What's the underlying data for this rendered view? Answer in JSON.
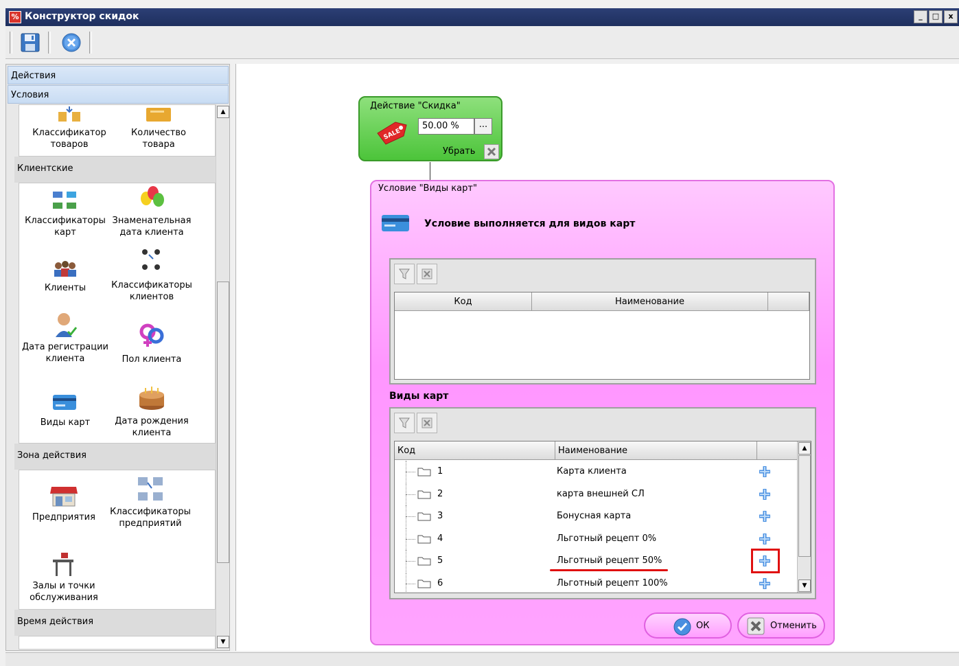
{
  "window": {
    "title": "Конструктор скидок",
    "app_icon_glyph": "%",
    "buttons": [
      "_",
      "□",
      "x"
    ]
  },
  "toolbar": {
    "icons": [
      "save-icon",
      "cancel-circle-icon"
    ]
  },
  "sidebar": {
    "headers": [
      "Действия",
      "Условия"
    ],
    "top_tiles": [
      {
        "label": "Классификатор товаров",
        "icon": "goods-classifier-icon"
      },
      {
        "label": "Количество товара",
        "icon": "goods-quantity-icon"
      }
    ],
    "sections": [
      {
        "title": "Клиентские",
        "tiles": [
          {
            "label": "Классификаторы карт",
            "icon": "card-classifier-icon"
          },
          {
            "label": "Знаменательная дата клиента",
            "icon": "balloons-icon"
          },
          {
            "label": "Клиенты",
            "icon": "clients-icon"
          },
          {
            "label": "Классификаторы клиентов",
            "icon": "client-classifier-icon"
          },
          {
            "label": "Дата регистрации клиента",
            "icon": "registration-date-icon"
          },
          {
            "label": "Пол клиента",
            "icon": "gender-icon"
          },
          {
            "label": "Виды карт",
            "icon": "cards-icon"
          },
          {
            "label": "Дата рождения клиента",
            "icon": "birthday-cake-icon"
          }
        ]
      },
      {
        "title": "Зона действия",
        "tiles": [
          {
            "label": "Предприятия",
            "icon": "store-icon"
          },
          {
            "label": "Классификаторы предприятий",
            "icon": "enterprise-classifier-icon"
          },
          {
            "label": "Залы и точки обслуживания",
            "icon": "service-point-icon"
          }
        ]
      },
      {
        "title": "Время действия",
        "tiles": []
      }
    ]
  },
  "action_node": {
    "title": "Действие \"Скидка\"",
    "value": "50.00 %",
    "dots": "...",
    "remove_label": "Убрать",
    "badge": "SALE"
  },
  "condition_node": {
    "title": "Условие \"Виды карт\"",
    "description": "Условие выполняется для видов карт",
    "selected_grid": {
      "columns": [
        "Код",
        "Наименование"
      ]
    },
    "section_label": "Виды карт",
    "cards_grid": {
      "columns": [
        "Код",
        "Наименование"
      ],
      "rows": [
        {
          "code": "1",
          "name": "Карта клиента"
        },
        {
          "code": "2",
          "name": "карта внешней СЛ"
        },
        {
          "code": "3",
          "name": "Бонусная карта"
        },
        {
          "code": "4",
          "name": "Льготный рецепт 0%"
        },
        {
          "code": "5",
          "name": "Льготный рецепт 50%",
          "highlighted": true
        },
        {
          "code": "6",
          "name": "Льготный рецепт 100%"
        }
      ]
    },
    "buttons": {
      "ok": "ОК",
      "cancel": "Отменить"
    }
  },
  "colors": {
    "action_node": "#4cc43a",
    "condition_node": "#ff96ff",
    "highlight": "#e01010",
    "plus": "#4a90e2"
  }
}
